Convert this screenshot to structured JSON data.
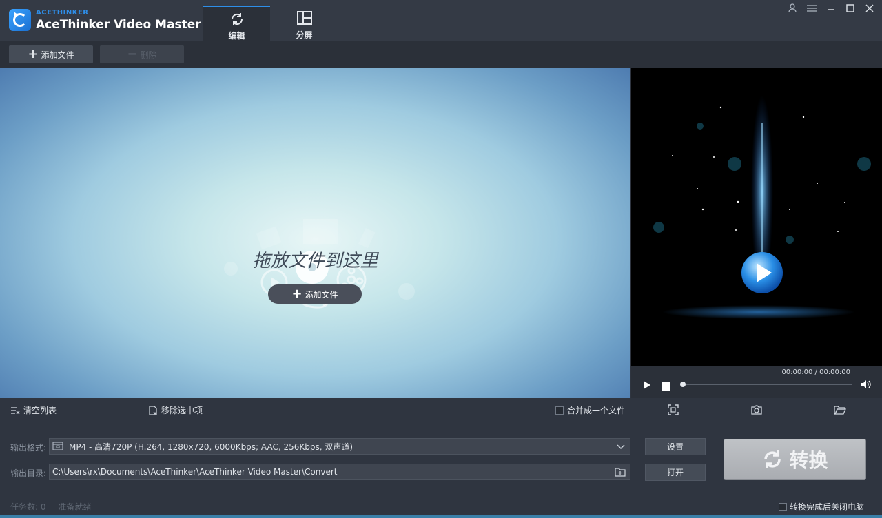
{
  "app": {
    "brand_small": "ACETHINKER",
    "title": "AceThinker Video Master"
  },
  "tabs": [
    {
      "label": "编辑",
      "icon": "refresh-icon",
      "active": true
    },
    {
      "label": "分屏",
      "icon": "split-screen-icon",
      "active": false
    }
  ],
  "window_controls": [
    "user-icon",
    "menu-icon",
    "minimize-icon",
    "maximize-icon",
    "close-icon"
  ],
  "toolbar": {
    "add_file_label": "添加文件",
    "delete_label": "删除"
  },
  "dropzone": {
    "hint": "拖放文件到这里",
    "add_file_label": "添加文件"
  },
  "player": {
    "time": "00:00:00 / 00:00:00",
    "progress": 0
  },
  "actions": {
    "clear_list": "清空列表",
    "remove_selected": "移除选中项",
    "merge_label": "合并成一个文件",
    "merge_checked": false
  },
  "output": {
    "format_label": "输出格式:",
    "format_value": "MP4 - 高清720P (H.264, 1280x720, 6000Kbps; AAC, 256Kbps, 双声道)",
    "dir_label": "输出目录:",
    "dir_value": "C:\\Users\\rx\\Documents\\AceThinker\\AceThinker Video Master\\Convert",
    "settings_button": "设置",
    "open_button": "打开",
    "convert_button": "转换"
  },
  "status": {
    "tasks": "任务数: 0",
    "state": "准备就绪",
    "shutdown_label": "转换完成后关闭电脑",
    "shutdown_checked": false
  },
  "colors": {
    "accent": "#2e8ee8",
    "titlebar": "#343a45",
    "panel": "#2f3540"
  }
}
